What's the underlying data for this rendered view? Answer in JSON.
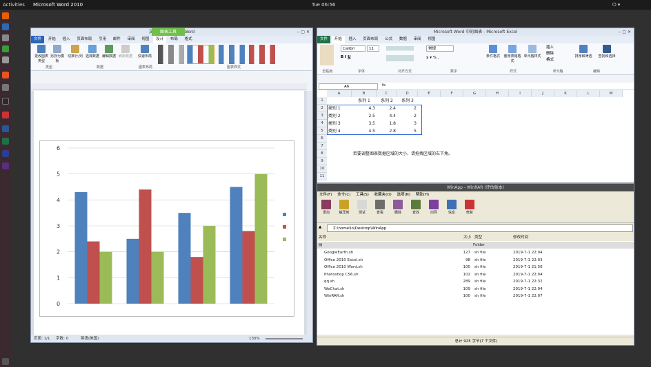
{
  "topbar": {
    "activities": "Activities",
    "app": "Microsoft Word 2010",
    "clock": "Tue 06:56"
  },
  "word": {
    "title": "文档1 - Microsoft Word",
    "context_tab": "图表工具",
    "tabs": [
      "文件",
      "开始",
      "插入",
      "页面布局",
      "引用",
      "邮件",
      "审阅",
      "视图",
      "设计",
      "布局",
      "格式"
    ],
    "buttons": [
      "更改图表类型",
      "另存为模板",
      "切换行/列",
      "选择数据",
      "编辑数据",
      "刷新数据",
      "快速布局"
    ],
    "groups": [
      "类型",
      "数据",
      "图表布局",
      "图表样式"
    ],
    "status": {
      "page": "页面: 1/1",
      "words": "字数: 0",
      "lang": "英语(美国)",
      "zoom": "130%"
    }
  },
  "chart_data": {
    "type": "bar",
    "categories": [
      "类别 1",
      "类别 2",
      "类别 3",
      "类别 4"
    ],
    "series": [
      {
        "name": "系列 1",
        "values": [
          4.3,
          2.5,
          3.5,
          4.5
        ],
        "color": "#4f81bd"
      },
      {
        "name": "系列 2",
        "values": [
          2.4,
          4.4,
          1.8,
          2.8
        ],
        "color": "#c0504d"
      },
      {
        "name": "系列 3",
        "values": [
          2,
          2,
          3,
          5
        ],
        "color": "#9bbb59"
      }
    ],
    "yticks": [
      "0",
      "1",
      "2",
      "3",
      "4",
      "5",
      "6"
    ],
    "ylim": [
      0,
      6
    ]
  },
  "excel": {
    "title": "Microsoft Word 中的图表 - Microsoft Excel",
    "tabs": [
      "文件",
      "开始",
      "插入",
      "页面布局",
      "公式",
      "数据",
      "审阅",
      "视图"
    ],
    "font": "Calibri",
    "size": "11",
    "numfmt": "常规",
    "groups": [
      "剪贴板",
      "字体",
      "对齐方式",
      "数字",
      "样式",
      "单元格",
      "编辑"
    ],
    "buttons": [
      "条件格式",
      "套用表格格式",
      "单元格样式",
      "插入",
      "删除",
      "格式",
      "排序和筛选",
      "查找和选择"
    ],
    "cellref": "A6",
    "cols": [
      "A",
      "B",
      "C",
      "D",
      "E",
      "F",
      "G",
      "H",
      "I",
      "J",
      "K",
      "L",
      "M"
    ],
    "rows": [
      "1",
      "2",
      "3",
      "4",
      "5",
      "6",
      "7",
      "8",
      "9",
      "10",
      "11"
    ],
    "headers": [
      "系列 1",
      "系列 2",
      "系列 3"
    ],
    "data": [
      [
        "类别 1",
        "4.3",
        "2.4",
        "2"
      ],
      [
        "类别 2",
        "2.5",
        "4.4",
        "2"
      ],
      [
        "类别 3",
        "3.5",
        "1.8",
        "3"
      ],
      [
        "类别 4",
        "4.5",
        "2.8",
        "5"
      ]
    ],
    "note": "若要调整图表数据区域的大小，请拖拽区域的右下角。"
  },
  "winrar": {
    "title": "WinApp - WinRAR (评估版本)",
    "menu": [
      "文件(F)",
      "命令(C)",
      "工具(S)",
      "收藏夹(O)",
      "选项(N)",
      "帮助(H)"
    ],
    "tools": [
      "添加",
      "解压到",
      "测试",
      "查看",
      "删除",
      "查找",
      "向导",
      "信息",
      "修复"
    ],
    "path": "Z:\\home\\lo\\Desktop\\WinApp",
    "columns": [
      "名称",
      "大小",
      "类型",
      "修改时间"
    ],
    "parent": "Folder",
    "files": [
      {
        "name": "GoogleEarth.sh",
        "size": "127",
        "type": "sh file",
        "date": "2019-7-1 22:04"
      },
      {
        "name": "Office 2010 Excel.sh",
        "size": "98",
        "type": "sh file",
        "date": "2019-7-1 22:03"
      },
      {
        "name": "Office 2010 Word.sh",
        "size": "100",
        "type": "sh file",
        "date": "2019-7-1 21:56"
      },
      {
        "name": "Photoshop CS6.sh",
        "size": "102",
        "type": "sh file",
        "date": "2019-7-1 22:04"
      },
      {
        "name": "qq.sh",
        "size": "289",
        "type": "sh file",
        "date": "2019-7-1 22:32"
      },
      {
        "name": "WeChat.sh",
        "size": "109",
        "type": "sh file",
        "date": "2019-7-1 22:04"
      },
      {
        "name": "WinRAR.sh",
        "size": "100",
        "type": "sh file",
        "date": "2019-7-1 22:07"
      }
    ],
    "status": "总计 925 字节(7 个文件)"
  }
}
